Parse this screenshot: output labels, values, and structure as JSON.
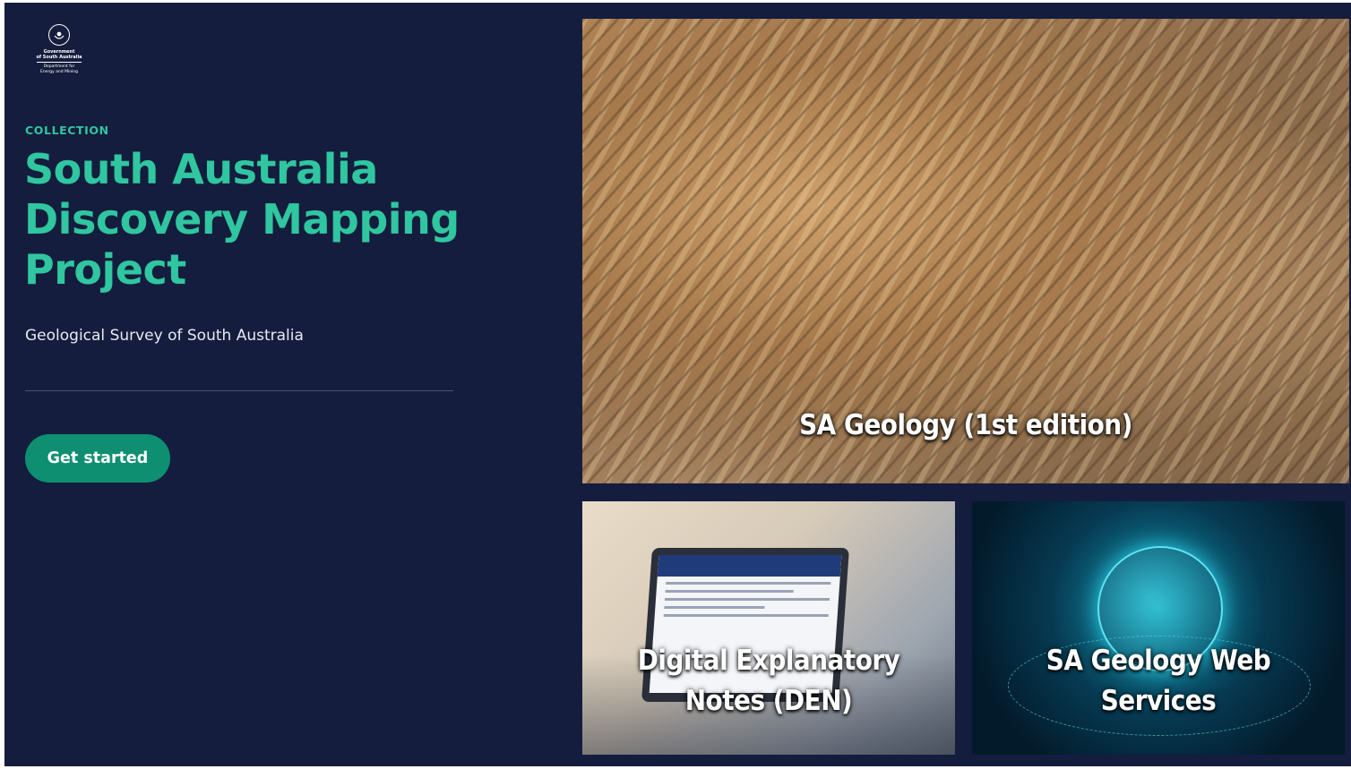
{
  "logo": {
    "line1": "Government",
    "line2": "of South Australia",
    "line3": "Department for",
    "line4": "Energy and Mining"
  },
  "hero": {
    "eyebrow": "COLLECTION",
    "title": "South Australia Discovery Mapping Project",
    "subtitle": "Geological Survey of South Australia",
    "cta_label": "Get started"
  },
  "cards": [
    {
      "label": "SA Geology (1st edition)"
    },
    {
      "label": "Digital Explanatory Notes (DEN)"
    },
    {
      "label": "SA Geology Web Services"
    }
  ],
  "colors": {
    "background": "#141d3d",
    "accent": "#2fc6a0",
    "button": "#0e8f72"
  }
}
